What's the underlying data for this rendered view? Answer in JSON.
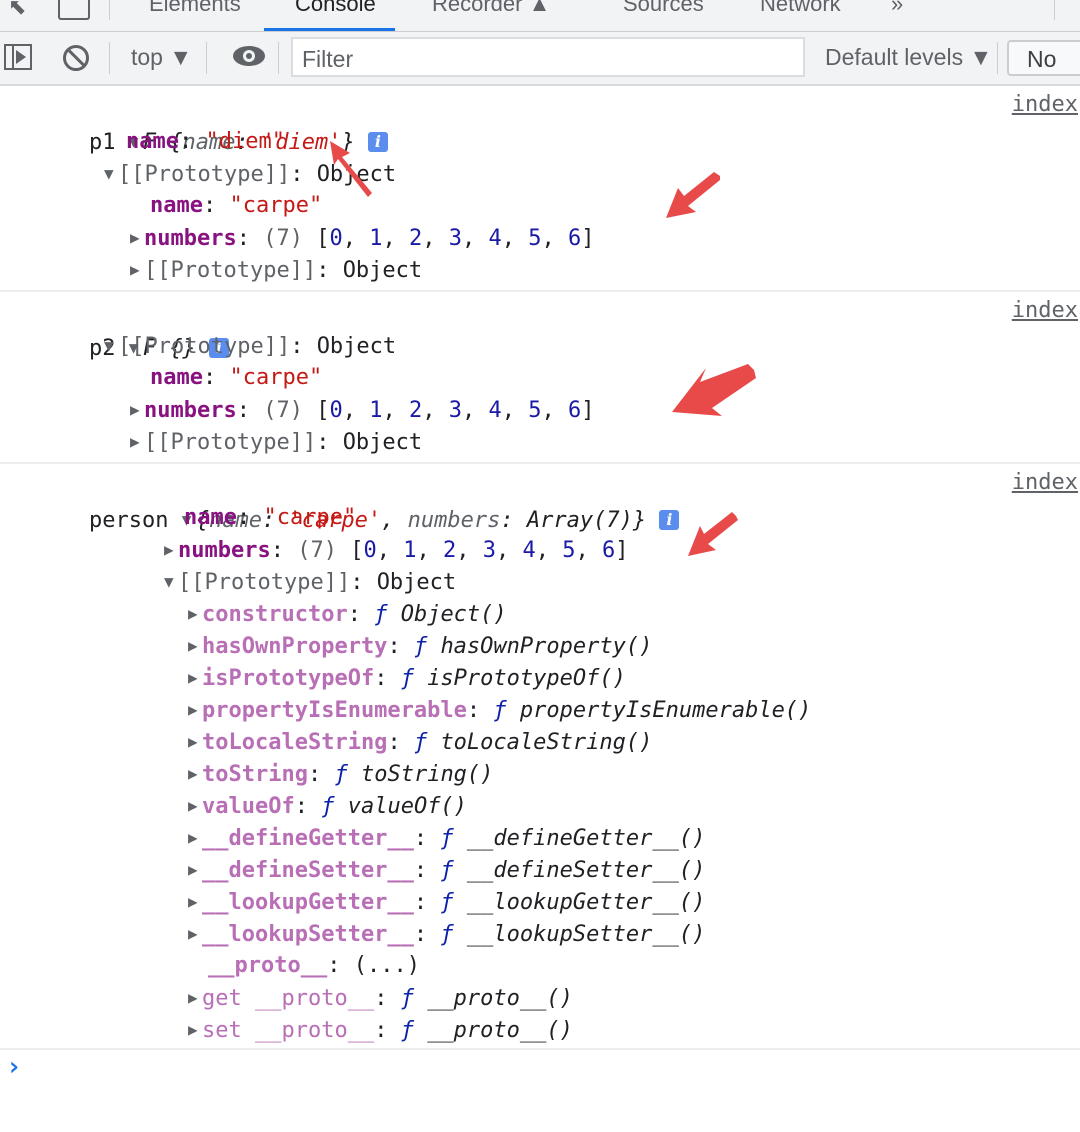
{
  "devtools": {
    "tabs": [
      {
        "label": "Elements",
        "active": false
      },
      {
        "label": "Console",
        "active": true
      },
      {
        "label": "Recorder ▲",
        "active": false
      },
      {
        "label": "Sources",
        "active": false
      },
      {
        "label": "Network",
        "active": false
      }
    ],
    "more_tabs": "»",
    "accent_color": "#1a73e8"
  },
  "toolbar": {
    "context": "top ▼",
    "filter_placeholder": "Filter",
    "levels": "Default levels ▼",
    "issues_button": "No"
  },
  "messages": [
    {
      "label": "p1",
      "source": "index",
      "summary_ctor": "F",
      "summary_open": " {",
      "summary_key": "name",
      "summary_val": "'diem'",
      "summary_close": "}",
      "own_name_key": "name",
      "own_name_val": "\"diem\"",
      "proto_label": "[[Prototype]]",
      "proto_type": "Object",
      "proto_name_key": "name",
      "proto_name_val": "\"carpe\"",
      "numbers_key": "numbers",
      "numbers_len": "(7)",
      "numbers": [
        "0",
        "1",
        "2",
        "3",
        "4",
        "5",
        "6"
      ],
      "inner_proto_label": "[[Prototype]]",
      "inner_proto_type": "Object"
    },
    {
      "label": "p2",
      "source": "index",
      "summary": "F {}",
      "proto_label": "[[Prototype]]",
      "proto_type": "Object",
      "proto_name_key": "name",
      "proto_name_val": "\"carpe\"",
      "numbers_key": "numbers",
      "numbers_len": "(7)",
      "numbers": [
        "0",
        "1",
        "2",
        "3",
        "4",
        "5",
        "6"
      ],
      "inner_proto_label": "[[Prototype]]",
      "inner_proto_type": "Object"
    },
    {
      "label": "person",
      "source": "index",
      "summary_k1": "name",
      "summary_v1": "'carpe'",
      "summary_k2": "numbers",
      "summary_v2": "Array(7)",
      "name_key": "name",
      "name_val": "\"carpe\"",
      "numbers_key": "numbers",
      "numbers_len": "(7)",
      "numbers": [
        "0",
        "1",
        "2",
        "3",
        "4",
        "5",
        "6"
      ],
      "proto_label": "[[Prototype]]",
      "proto_type": "Object",
      "proto_members": [
        {
          "key": "constructor",
          "fn": "Object()"
        },
        {
          "key": "hasOwnProperty",
          "fn": "hasOwnProperty()"
        },
        {
          "key": "isPrototypeOf",
          "fn": "isPrototypeOf()"
        },
        {
          "key": "propertyIsEnumerable",
          "fn": "propertyIsEnumerable()"
        },
        {
          "key": "toLocaleString",
          "fn": "toLocaleString()"
        },
        {
          "key": "toString",
          "fn": "toString()"
        },
        {
          "key": "valueOf",
          "fn": "valueOf()"
        },
        {
          "key": "__defineGetter__",
          "fn": "__defineGetter__()"
        },
        {
          "key": "__defineSetter__",
          "fn": "__defineSetter__()"
        },
        {
          "key": "__lookupGetter__",
          "fn": "__lookupGetter__()"
        },
        {
          "key": "__lookupSetter__",
          "fn": "__lookupSetter__()"
        }
      ],
      "proto_accessor": {
        "key": "__proto__",
        "value": "(...)"
      },
      "getter": {
        "key": "get __proto__",
        "fn": "__proto__()"
      },
      "setter": {
        "key": "set __proto__",
        "fn": "__proto__()"
      }
    }
  ],
  "annotations": {
    "arrow_color": "#e84a4a"
  },
  "prompt_symbol": "›"
}
